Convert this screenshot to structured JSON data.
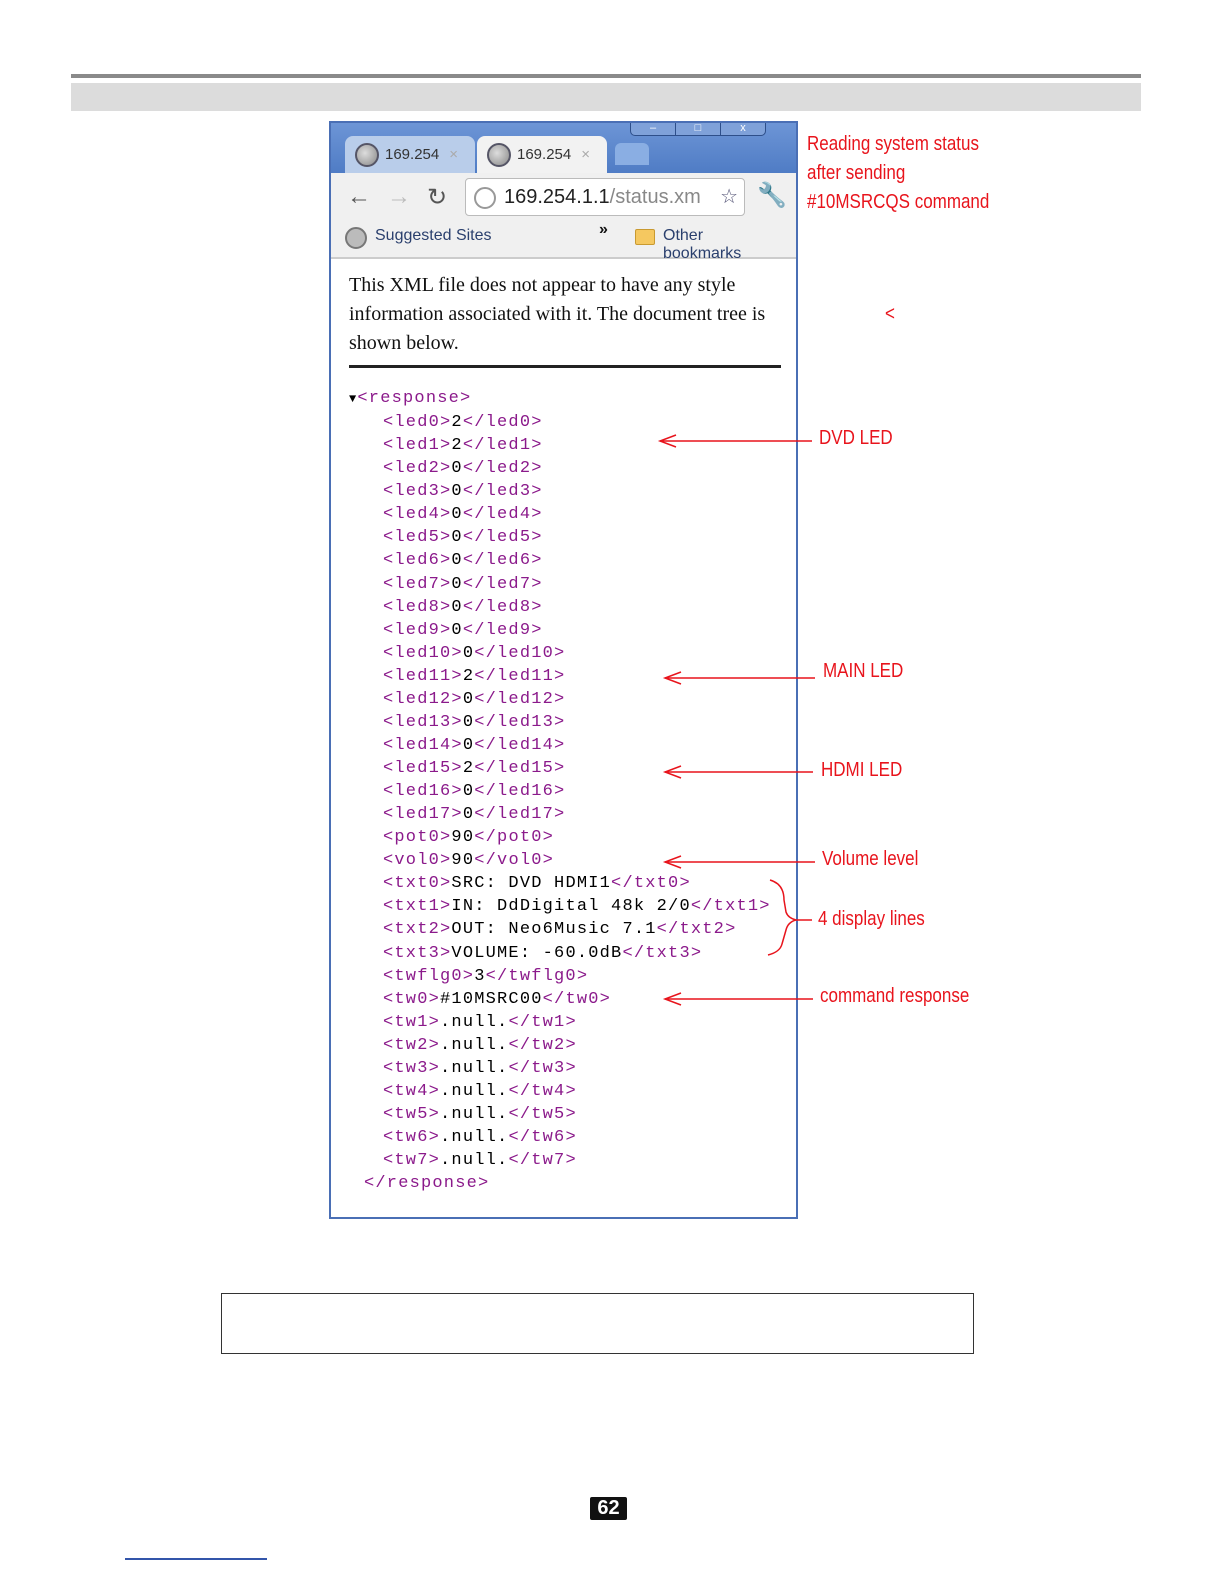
{
  "browser": {
    "tabs": [
      {
        "label": "169.254",
        "close": "×"
      },
      {
        "label": "169.254",
        "close": "×"
      }
    ],
    "window_buttons": [
      "–",
      "□",
      "x"
    ],
    "address": {
      "host": "169.254.1.1",
      "path": "/status.xm"
    },
    "bookmarks": {
      "suggested": "Suggested Sites",
      "more": "»",
      "other": "Other bookmarks"
    },
    "notice": "This XML file does not appear to have any style information associated with it. The document tree is shown below.",
    "xml": {
      "root_open": "<response>",
      "root_close": "</response>",
      "elements": [
        {
          "tag": "led0",
          "value": "2"
        },
        {
          "tag": "led1",
          "value": "2"
        },
        {
          "tag": "led2",
          "value": "0"
        },
        {
          "tag": "led3",
          "value": "0"
        },
        {
          "tag": "led4",
          "value": "0"
        },
        {
          "tag": "led5",
          "value": "0"
        },
        {
          "tag": "led6",
          "value": "0"
        },
        {
          "tag": "led7",
          "value": "0"
        },
        {
          "tag": "led8",
          "value": "0"
        },
        {
          "tag": "led9",
          "value": "0"
        },
        {
          "tag": "led10",
          "value": "0"
        },
        {
          "tag": "led11",
          "value": "2"
        },
        {
          "tag": "led12",
          "value": "0"
        },
        {
          "tag": "led13",
          "value": "0"
        },
        {
          "tag": "led14",
          "value": "0"
        },
        {
          "tag": "led15",
          "value": "2"
        },
        {
          "tag": "led16",
          "value": "0"
        },
        {
          "tag": "led17",
          "value": "0"
        },
        {
          "tag": "pot0",
          "value": "90"
        },
        {
          "tag": "vol0",
          "value": "90"
        },
        {
          "tag": "txt0",
          "value": "SRC: DVD HDMI1"
        },
        {
          "tag": "txt1",
          "value": "IN: DdDigital 48k 2/0"
        },
        {
          "tag": "txt2",
          "value": "OUT: Neo6Music 7.1"
        },
        {
          "tag": "txt3",
          "value": "VOLUME: -60.0dB"
        },
        {
          "tag": "twflg0",
          "value": "3"
        },
        {
          "tag": "tw0",
          "value": "#10MSRC00"
        },
        {
          "tag": "tw1",
          "value": ".null."
        },
        {
          "tag": "tw2",
          "value": ".null."
        },
        {
          "tag": "tw3",
          "value": ".null."
        },
        {
          "tag": "tw4",
          "value": ".null."
        },
        {
          "tag": "tw5",
          "value": ".null."
        },
        {
          "tag": "tw6",
          "value": ".null."
        },
        {
          "tag": "tw7",
          "value": ".null."
        }
      ]
    }
  },
  "annotations": {
    "title": [
      "Reading system status",
      "after sending",
      "#10MSRCQS command"
    ],
    "stray": "<",
    "dvd": "DVD LED",
    "main": "MAIN LED",
    "hdmi": "HDMI LED",
    "volume": "Volume level",
    "display": "4 display lines",
    "command": "command response"
  },
  "page_number": "62",
  "colors": {
    "annotation": "#e8141c",
    "xml_tag": "#8b1a8b",
    "window_frame": "#4a6fb5"
  }
}
